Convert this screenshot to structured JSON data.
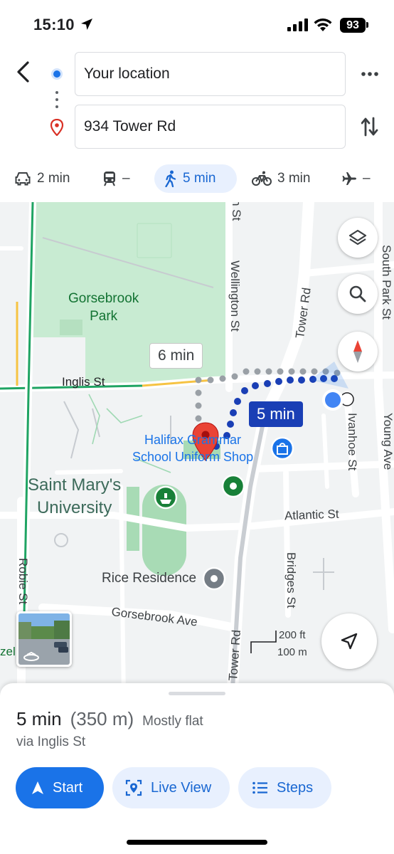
{
  "status_bar": {
    "time": "15:10",
    "battery": "93"
  },
  "header": {
    "from_value": "Your location",
    "to_value": "934 Tower Rd"
  },
  "modes": [
    {
      "name": "drive",
      "label": "2 min"
    },
    {
      "name": "transit",
      "label": "–"
    },
    {
      "name": "walk",
      "label": "5 min",
      "active": true
    },
    {
      "name": "bike",
      "label": "3 min"
    },
    {
      "name": "flight",
      "label": "–"
    }
  ],
  "map": {
    "labels": {
      "park": "Gorsebrook\nPark",
      "university": "Saint Mary's\nUniversity",
      "inglis": "Inglis St",
      "wellington": "Wellington St",
      "tower_top": "Tower Rd",
      "tower_bottom": "Tower Rd",
      "south_park": "South Park St",
      "young": "Young Ave",
      "ivanhoe": "Ivanhoe St",
      "atlantic": "Atlantic St",
      "bridges": "Bridges St",
      "robie": "Robie St",
      "gorsebrook_ave": "Gorsebrook Ave",
      "rice": "Rice Residence",
      "halifax_school": "Halifax Grammar\nSchool Uniform Shop",
      "partial_top": "n St",
      "partial_left": "zel"
    },
    "alt_route_time": "6 min",
    "route_time": "5 min",
    "scale_ft": "200 ft",
    "scale_m": "100 m"
  },
  "sheet": {
    "duration": "5 min",
    "distance": "(350 m)",
    "terrain": "Mostly flat",
    "via": "via Inglis St",
    "start_label": "Start",
    "live_view_label": "Live View",
    "steps_label": "Steps"
  },
  "colors": {
    "accent": "#1a73e8",
    "route": "#1a3fb5",
    "park": "#c8ebd2",
    "pin": "#ea4335"
  }
}
